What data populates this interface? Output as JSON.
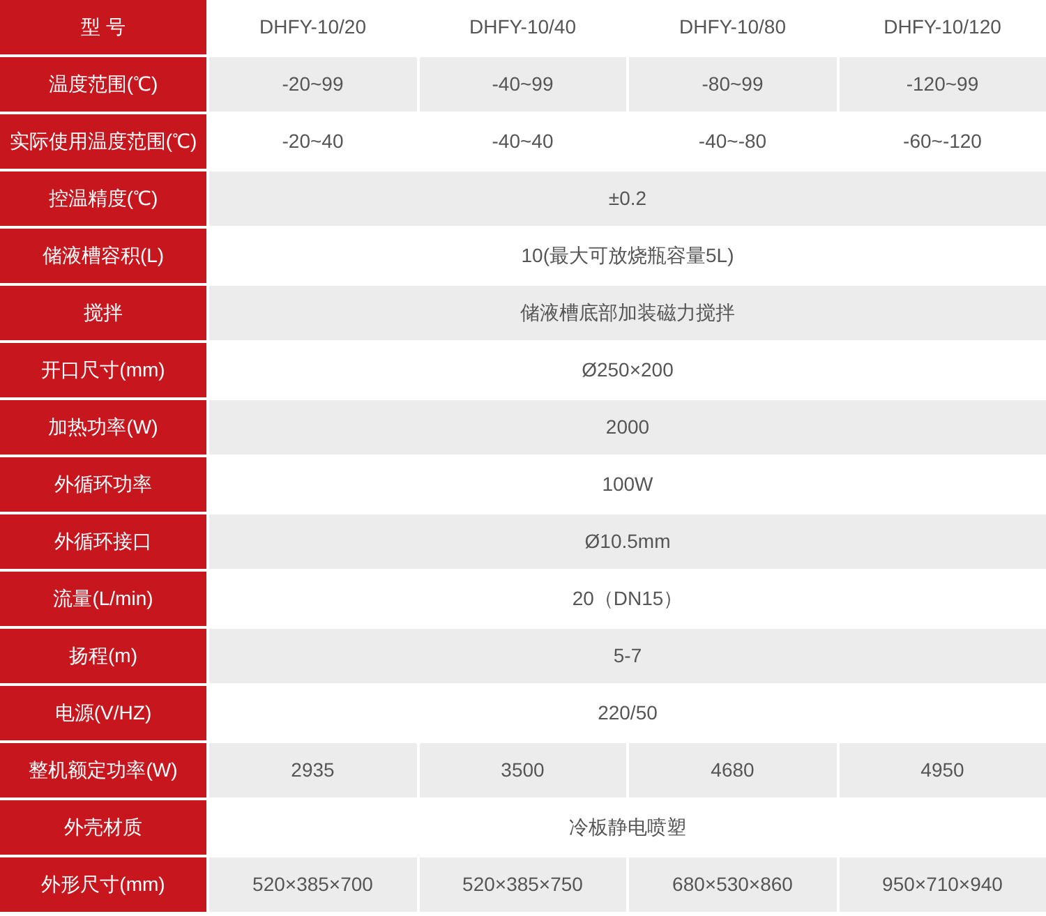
{
  "header": {
    "label": "型 号",
    "models": [
      "DHFY-10/20",
      "DHFY-10/40",
      "DHFY-10/80",
      "DHFY-10/120"
    ]
  },
  "rows": [
    {
      "label": "温度范围(℃)",
      "values": [
        "-20~99",
        "-40~99",
        "-80~99",
        "-120~99"
      ]
    },
    {
      "label": "实际使用温度范围(℃)",
      "values": [
        "-20~40",
        "-40~40",
        "-40~-80",
        "-60~-120"
      ]
    },
    {
      "label": "控温精度(℃)",
      "values": [
        "±0.2"
      ]
    },
    {
      "label": "储液槽容积(L)",
      "values": [
        "10(最大可放烧瓶容量5L)"
      ]
    },
    {
      "label": "搅拌",
      "values": [
        "储液槽底部加装磁力搅拌"
      ]
    },
    {
      "label": "开口尺寸(mm)",
      "values": [
        "Ø250×200"
      ]
    },
    {
      "label": "加热功率(W)",
      "values": [
        "2000"
      ]
    },
    {
      "label": "外循环功率",
      "values": [
        "100W"
      ]
    },
    {
      "label": "外循环接口",
      "values": [
        "Ø10.5mm"
      ]
    },
    {
      "label": "流量(L/min)",
      "values": [
        "20（DN15）"
      ]
    },
    {
      "label": "扬程(m)",
      "values": [
        "5-7"
      ]
    },
    {
      "label": "电源(V/HZ)",
      "values": [
        "220/50"
      ]
    },
    {
      "label": "整机额定功率(W)",
      "values": [
        "2935",
        "3500",
        "4680",
        "4950"
      ]
    },
    {
      "label": "外壳材质",
      "values": [
        "冷板静电喷塑"
      ]
    },
    {
      "label": "外形尺寸(mm)",
      "values": [
        "520×385×700",
        "520×385×750",
        "680×530×860",
        "950×710×940"
      ]
    }
  ]
}
